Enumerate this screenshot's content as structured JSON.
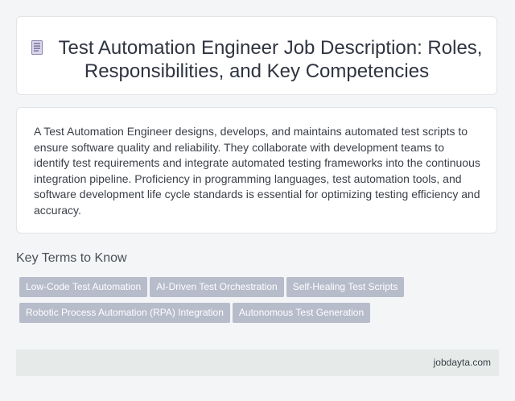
{
  "header": {
    "title": "Test Automation Engineer Job Description: Roles, Responsibilities, and Key Competencies",
    "icon": "document-icon"
  },
  "description": {
    "text": "A Test Automation Engineer designs, develops, and maintains automated test scripts to ensure software quality and reliability. They collaborate with development teams to identify test requirements and integrate automated testing frameworks into the continuous integration pipeline. Proficiency in programming languages, test automation tools, and software development life cycle standards is essential for optimizing testing efficiency and accuracy."
  },
  "key_terms": {
    "heading": "Key Terms to Know",
    "tags": [
      "Low-Code Test Automation",
      "AI-Driven Test Orchestration",
      "Self-Healing Test Scripts",
      "Robotic Process Automation (RPA) Integration",
      "Autonomous Test Generation"
    ]
  },
  "footer": {
    "site": "jobdayta.com"
  },
  "colors": {
    "tag_background": "#b7bccb",
    "footer_background": "#e6ebe9",
    "page_background": "#f4f5f7"
  }
}
